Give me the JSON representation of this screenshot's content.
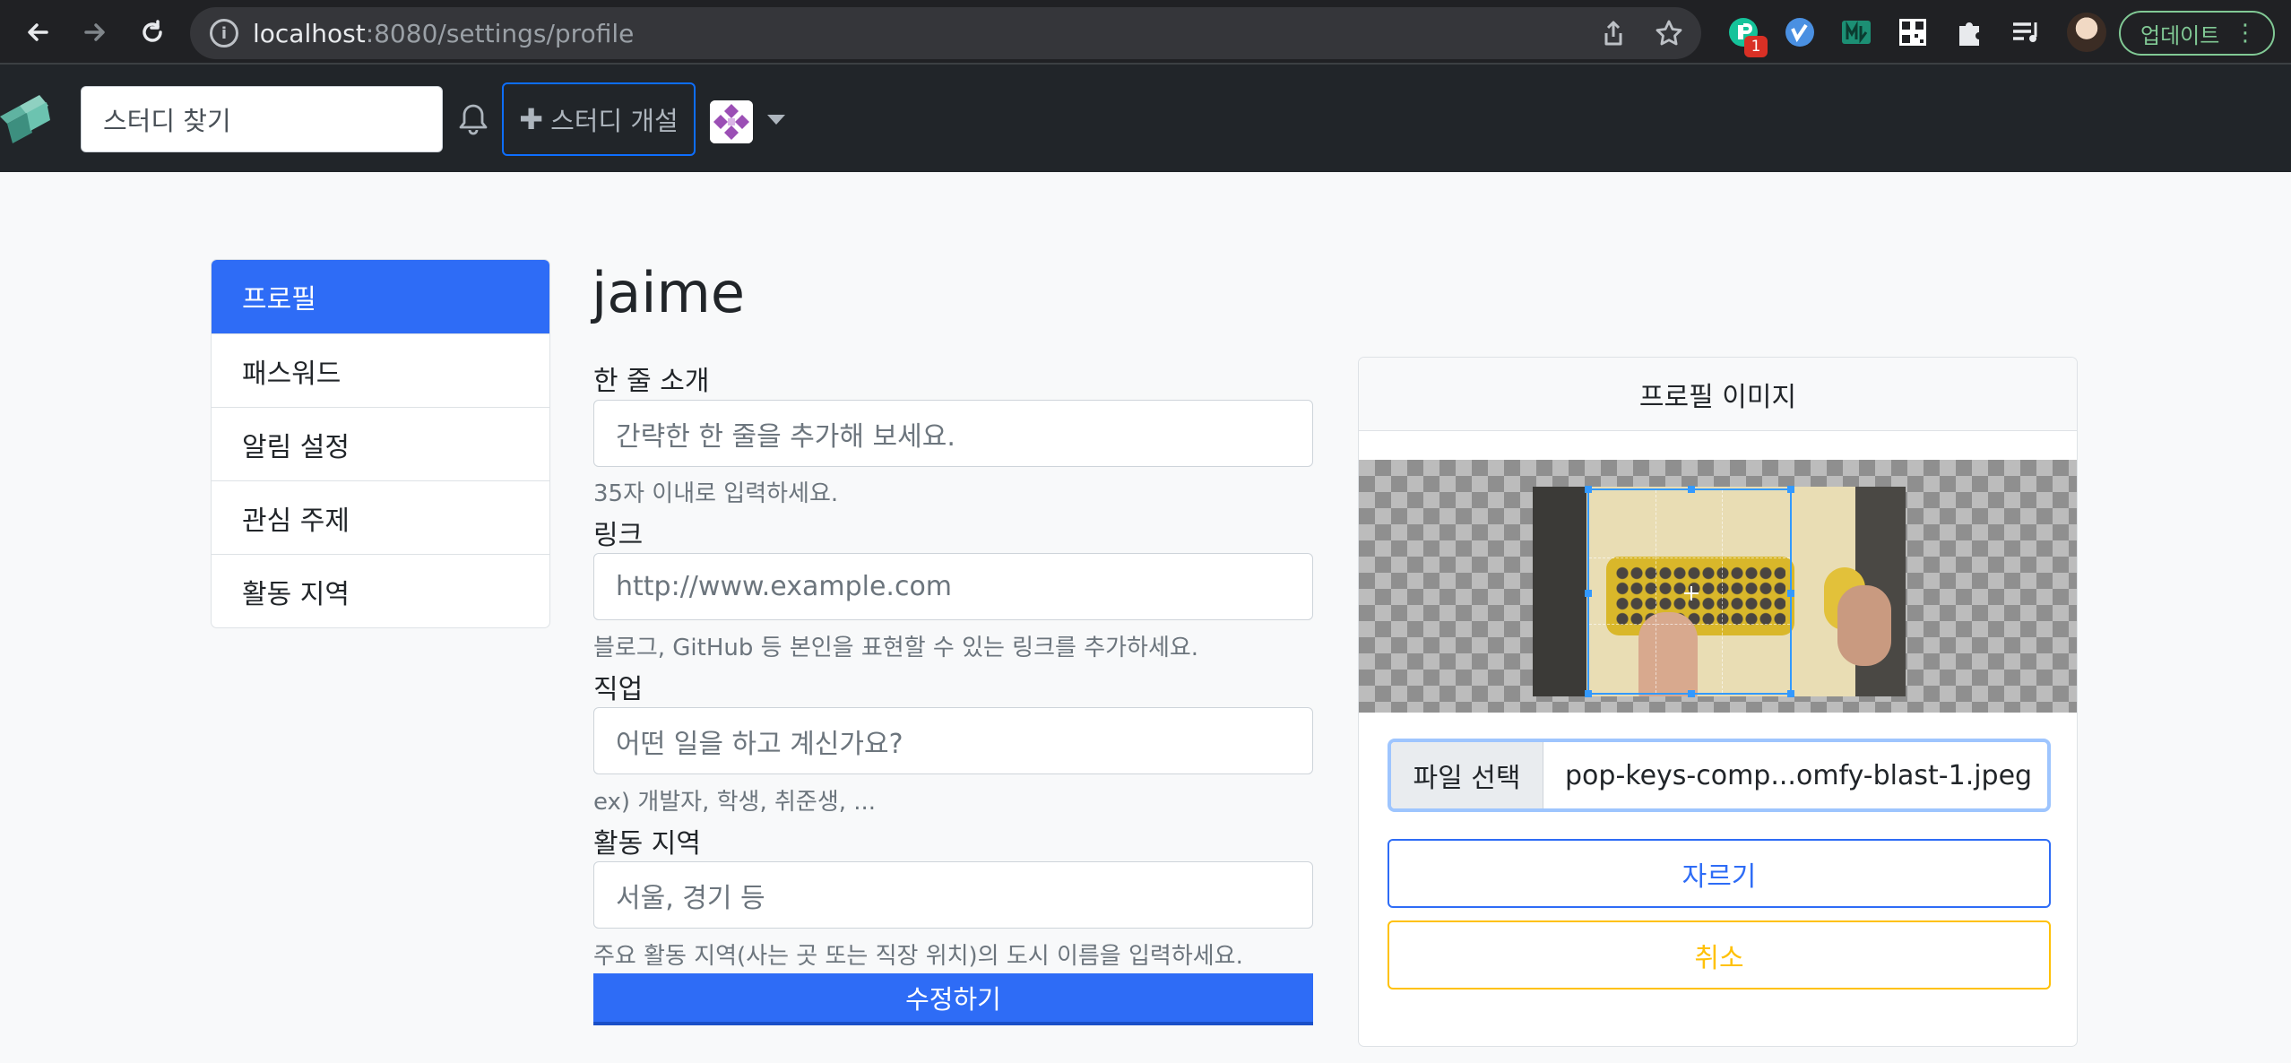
{
  "browser": {
    "url_host": "localhost",
    "url_path": ":8080/settings/profile",
    "ext_badge": "1",
    "update_label": "업데이트"
  },
  "navbar": {
    "search_placeholder": "스터디 찾기",
    "create_label": "스터디 개설"
  },
  "sidebar": {
    "items": [
      {
        "label": "프로필",
        "active": true
      },
      {
        "label": "패스워드",
        "active": false
      },
      {
        "label": "알림 설정",
        "active": false
      },
      {
        "label": "관심 주제",
        "active": false
      },
      {
        "label": "활동 지역",
        "active": false
      }
    ]
  },
  "profile": {
    "username": "jaime",
    "bio": {
      "label": "한 줄 소개",
      "placeholder": "간략한 한 줄을 추가해 보세요.",
      "help": "35자 이내로 입력하세요."
    },
    "url": {
      "label": "링크",
      "placeholder": "http://www.example.com",
      "help": "블로그, GitHub 등 본인을 표현할 수 있는 링크를 추가하세요."
    },
    "occupation": {
      "label": "직업",
      "placeholder": "어떤 일을 하고 계신가요?",
      "help": "ex) 개발자, 학생, 취준생, ..."
    },
    "location": {
      "label": "활동 지역",
      "placeholder": "서울, 경기 등",
      "help": "주요 활동 지역(사는 곳 또는 직장 위치)의 도시 이름을 입력하세요."
    },
    "submit_label": "수정하기"
  },
  "image_card": {
    "header": "프로필 이미지",
    "file_button": "파일 선택",
    "file_name": "pop-keys-comp...omfy-blast-1.jpeg",
    "crop_label": "자르기",
    "cancel_label": "취소"
  },
  "colors": {
    "primary": "#2e6cf6",
    "warning": "#ffc107",
    "navbar": "#212529"
  }
}
